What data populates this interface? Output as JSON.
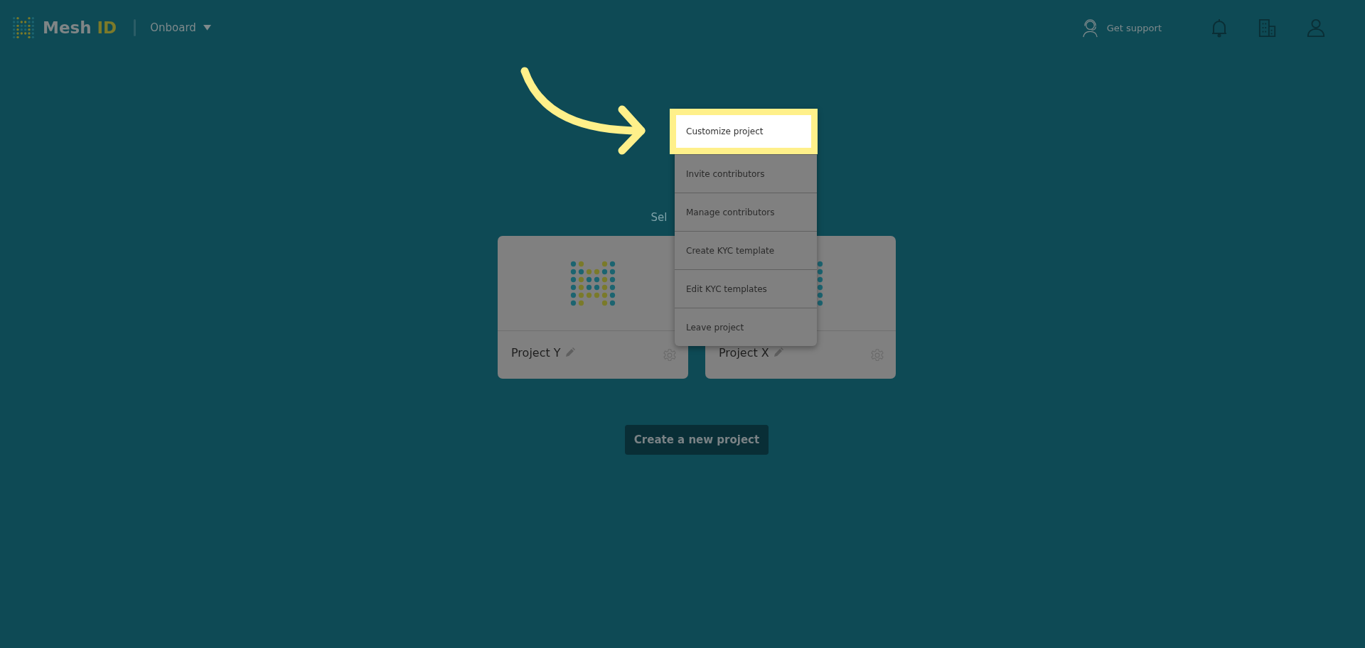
{
  "header": {
    "logo_text": "Mesh",
    "logo_accent": "ID",
    "workspace": "Onboard",
    "support_label": "Get support"
  },
  "subtitle": "Sel",
  "projects": [
    {
      "name": "Project Y"
    },
    {
      "name": "Project X"
    }
  ],
  "menu": [
    {
      "label": "Customize project",
      "selected": true
    },
    {
      "label": "Invite contributors",
      "selected": false
    },
    {
      "label": "Manage contributors",
      "selected": false
    },
    {
      "label": "Create KYC template",
      "selected": false
    },
    {
      "label": "Edit KYC templates",
      "selected": false
    },
    {
      "label": "Leave project",
      "selected": false
    }
  ],
  "create_button": "Create a new project"
}
